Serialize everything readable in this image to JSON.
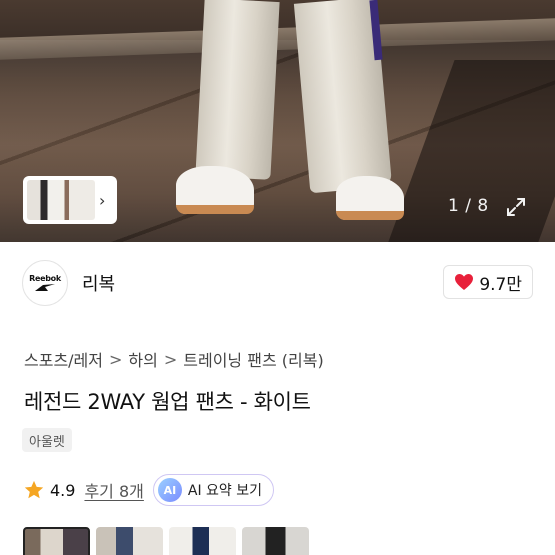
{
  "gallery": {
    "counter": "1 / 8",
    "icons": {
      "next": "chevron-right-icon",
      "expand": "expand-arrows-icon"
    }
  },
  "brand": {
    "logo_text": "Reebok",
    "name": "리복",
    "likes": "9.7만",
    "heart_color": "#e8203a"
  },
  "breadcrumb": {
    "items": [
      "스포츠/레저",
      "하의",
      "트레이닝 팬츠 (리복)"
    ],
    "separator": ">"
  },
  "product": {
    "title": "레전드 2WAY 웜업 팬츠 - 화이트",
    "tag": "아울렛"
  },
  "rating": {
    "score": "4.9",
    "reviews": "후기 8개",
    "star_color": "#f5a623"
  },
  "ai": {
    "badge": "AI",
    "label": "AI 요약 보기"
  }
}
